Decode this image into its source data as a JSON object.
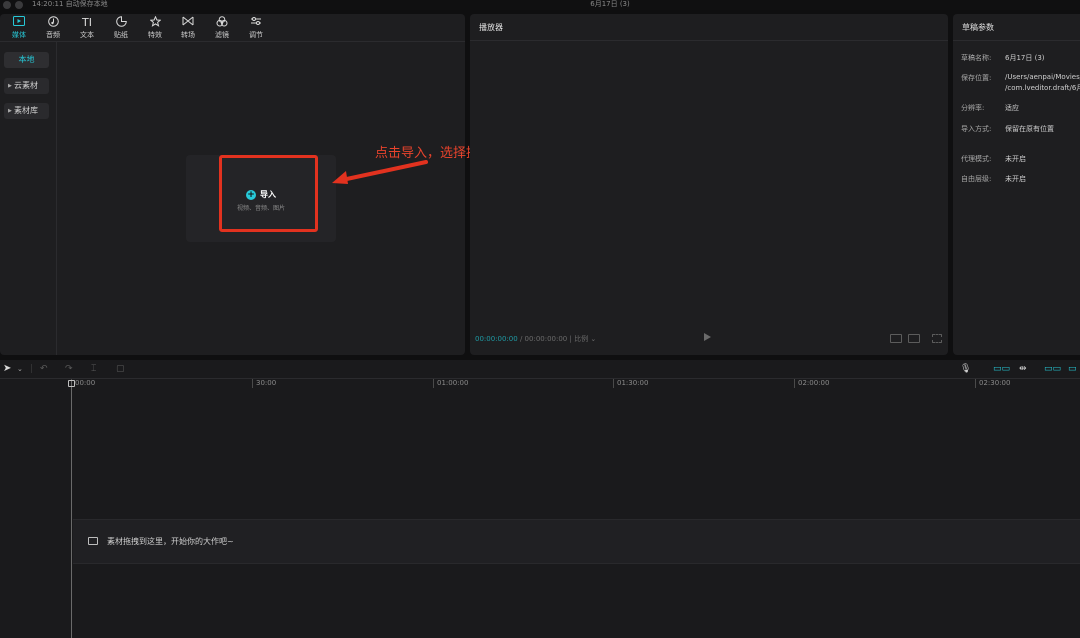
{
  "window": {
    "status": "14:20:11 自动保存本地",
    "title": "6月17日 (3)"
  },
  "toolbar": {
    "tabs": [
      {
        "label": "媒体",
        "icon": "media-icon"
      },
      {
        "label": "音频",
        "icon": "audio-icon"
      },
      {
        "label": "文本",
        "icon": "text-icon"
      },
      {
        "label": "贴纸",
        "icon": "sticker-icon"
      },
      {
        "label": "特效",
        "icon": "effects-icon"
      },
      {
        "label": "转场",
        "icon": "transition-icon"
      },
      {
        "label": "滤镜",
        "icon": "filter-icon"
      },
      {
        "label": "调节",
        "icon": "adjust-icon"
      }
    ],
    "active_tab": "媒体"
  },
  "sidebar": {
    "items": [
      {
        "label": "本地"
      },
      {
        "label": "云素材"
      },
      {
        "label": "素材库"
      }
    ]
  },
  "import_card": {
    "title": "导入",
    "subtitle": "视频、音频、图片"
  },
  "annotation": {
    "text": "点击导入，选择提前准备好的照片和视频文件"
  },
  "player": {
    "title": "播放器",
    "current_time": "00:00:00:00",
    "total_time": "00:00:00:00",
    "ratio_label": "比例"
  },
  "params": {
    "title": "草稿参数",
    "rows": [
      {
        "label": "草稿名称:",
        "value": "6月17日 (3)"
      },
      {
        "label": "保存位置:",
        "value": "/Users/aenpai/Movies/",
        "value2": "/com.lveditor.draft/6月"
      },
      {
        "label": "分辨率:",
        "value": "适应"
      },
      {
        "label": "导入方式:",
        "value": "保留在原有位置"
      },
      {
        "label": "代理模式:",
        "value": "未开启"
      },
      {
        "label": "自由层级:",
        "value": "未开启"
      }
    ]
  },
  "timeline": {
    "ticks": [
      "00:00",
      "30:00",
      "01:00:00",
      "01:30:00",
      "02:00:00",
      "02:30:00"
    ],
    "drop_hint": "素材拖拽到这里，开始你的大作吧~"
  },
  "colors": {
    "accent": "#27c9d8",
    "annotation": "#e8432c"
  }
}
